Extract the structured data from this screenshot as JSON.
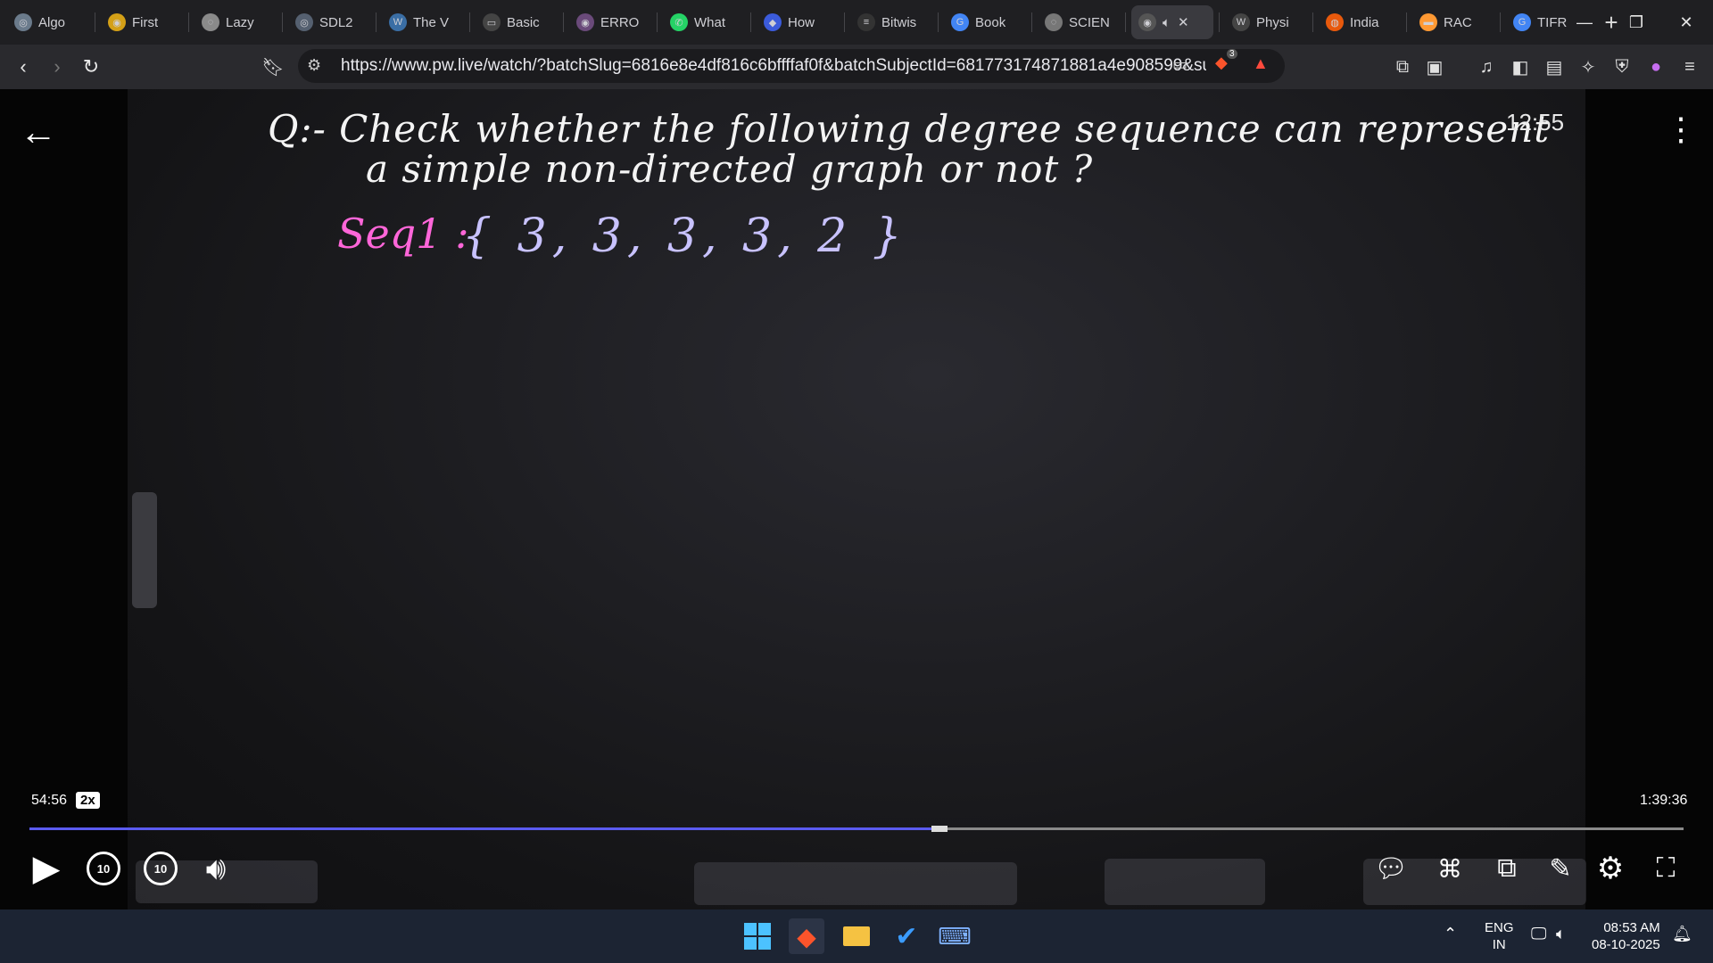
{
  "browser": {
    "tabs": [
      {
        "title": "Algo",
        "fav_color": "#6b7b8c",
        "fav_glyph": "◎",
        "active": false
      },
      {
        "title": "First",
        "fav_color": "#d4a017",
        "fav_glyph": "◉",
        "active": false
      },
      {
        "title": "Lazy",
        "fav_color": "#8a8a8a",
        "fav_glyph": "◌",
        "active": false
      },
      {
        "title": "SDL2",
        "fav_color": "#556070",
        "fav_glyph": "◎",
        "active": false
      },
      {
        "title": "The V",
        "fav_color": "#3a6ea5",
        "fav_glyph": "W",
        "active": false
      },
      {
        "title": "Basic",
        "fav_color": "#444444",
        "fav_glyph": "▭",
        "active": false
      },
      {
        "title": "ERRO",
        "fav_color": "#6a4a7a",
        "fav_glyph": "◉",
        "active": false
      },
      {
        "title": "What",
        "fav_color": "#25d366",
        "fav_glyph": "✆",
        "active": false
      },
      {
        "title": "How",
        "fav_color": "#3b5bdb",
        "fav_glyph": "◆",
        "active": false
      },
      {
        "title": "Bitwis",
        "fav_color": "#333333",
        "fav_glyph": "≡",
        "active": false
      },
      {
        "title": "Book",
        "fav_color": "#4285f4",
        "fav_glyph": "G",
        "active": false
      },
      {
        "title": "SCIEN",
        "fav_color": "#777777",
        "fav_glyph": "◌",
        "active": false
      },
      {
        "title": "",
        "fav_color": "#555555",
        "fav_glyph": "◉",
        "active": true
      },
      {
        "title": "Physi",
        "fav_color": "#444444",
        "fav_glyph": "W",
        "active": false
      },
      {
        "title": "India",
        "fav_color": "#e8590c",
        "fav_glyph": "◍",
        "active": false
      },
      {
        "title": "RAC",
        "fav_color": "#ff9933",
        "fav_glyph": "▬",
        "active": false
      },
      {
        "title": "TIFR",
        "fav_color": "#4285f4",
        "fav_glyph": "G",
        "active": false
      }
    ],
    "new_tab_label": "+",
    "url": "https://www.pw.live/watch/?batchSlug=6816e8e4df816c6bffffaf0f&batchSubjectId=681773174871881a4e908599&su...",
    "shields_count": "3"
  },
  "video": {
    "question_line1": "Q:- Check whether the following degree sequence can represent",
    "question_line2": "a simple non-directed graph or not ?",
    "seq_label": "Seq1 :",
    "seq_values": "{ 3, 3, 3, 3, 2 }",
    "timer": "12:55",
    "current_time": "54:56",
    "speed": "2x",
    "total_time": "1:39:36",
    "progress_fraction": 0.55,
    "skip_back": "10",
    "skip_forward": "10"
  },
  "taskbar": {
    "lang_line1": "ENG",
    "lang_line2": "IN",
    "time": "08:53 AM",
    "date": "08-10-2025"
  },
  "colors": {
    "seq_label": "#ff66d9",
    "seq_values": "#c8c2ff",
    "progress": "#5b5bf0"
  }
}
